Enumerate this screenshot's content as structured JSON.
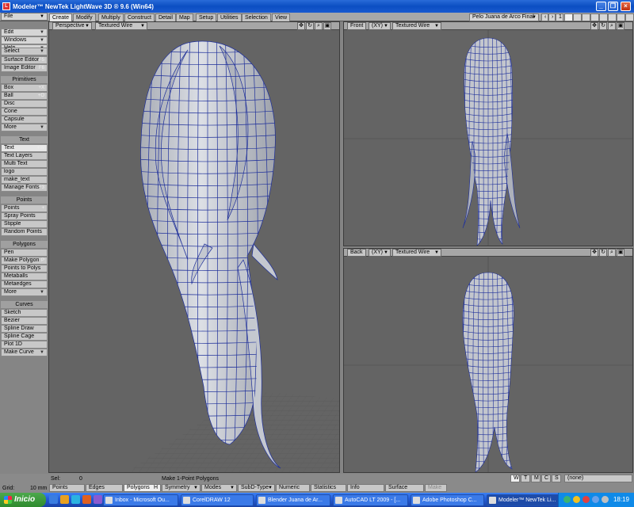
{
  "window": {
    "title": "Modeler™ NewTek LightWave 3D ® 9.6  (Win64)"
  },
  "menus": [
    {
      "label": "File"
    },
    {
      "label": "Edit"
    },
    {
      "label": "Windows"
    },
    {
      "label": "Help"
    }
  ],
  "tabs": [
    "Create",
    "Modify",
    "Multiply",
    "Construct",
    "Detail",
    "Map",
    "Setup",
    "Utilities",
    "Selection",
    "View"
  ],
  "active_tab": "Create",
  "object_selector": "Pelo Juana de Arco Final",
  "layer_number": "1",
  "sidebar": {
    "top": [
      {
        "label": "Select",
        "arrow": true
      },
      {
        "label": "Surface Editor",
        "shortcut": "F5"
      },
      {
        "label": "Image Editor",
        "shortcut": "F6"
      }
    ],
    "groups": [
      {
        "header": "Primitives",
        "items": [
          {
            "label": "Box",
            "shortcut": "+X"
          },
          {
            "label": "Ball",
            "shortcut": "+O"
          },
          {
            "label": "Disc"
          },
          {
            "label": "Cone"
          },
          {
            "label": "Capsule"
          },
          {
            "label": "More",
            "arrow": true
          }
        ]
      },
      {
        "header": "Text",
        "items": [
          {
            "label": "Text",
            "shortcut": "+W"
          },
          {
            "label": "Text Layers"
          },
          {
            "label": "Multi Text"
          },
          {
            "label": "logo"
          },
          {
            "label": "make_text"
          },
          {
            "label": "Manage Fonts",
            "shortcut": "F3"
          }
        ]
      },
      {
        "header": "Points",
        "items": [
          {
            "label": "Points",
            "shortcut": "+"
          },
          {
            "label": "Spray Points"
          },
          {
            "label": "Stipple"
          },
          {
            "label": "Random Points"
          }
        ]
      },
      {
        "header": "Polygons",
        "items": [
          {
            "label": "Pen"
          },
          {
            "label": "Make Polygon",
            "shortcut": "P"
          },
          {
            "label": "Points to Polys"
          },
          {
            "label": "Metaballs"
          },
          {
            "label": "Metaedges"
          },
          {
            "label": "More",
            "arrow": true
          }
        ]
      },
      {
        "header": "Curves",
        "items": [
          {
            "label": "Sketch"
          },
          {
            "label": "Bezier"
          },
          {
            "label": "Spline Draw"
          },
          {
            "label": "Spline Cage"
          },
          {
            "label": "Plot 1D"
          },
          {
            "label": "Make Curve",
            "arrow": true
          }
        ]
      }
    ]
  },
  "viewports": [
    {
      "view": "Perspective",
      "axis": "",
      "mode": "Textured Wire"
    },
    {
      "view": "Front",
      "axis": "(XY)",
      "mode": "Textured Wire"
    },
    {
      "view": "Back",
      "axis": "(XY)",
      "mode": "Textured Wire"
    }
  ],
  "status": {
    "grid_label": "Grid:",
    "grid_value": "10 mm",
    "sel_label": "Sel:",
    "sel_value": "0",
    "hint": "Make 1-Point Polygons",
    "wtmcs": [
      "W",
      "T",
      "M",
      "C",
      "S"
    ],
    "surface_value": "(none)",
    "modes": [
      {
        "label": "Points"
      },
      {
        "label": "Edges"
      },
      {
        "label": "Polygons",
        "shortcut": "H"
      },
      {
        "label": "Symmetry",
        "arrow": true
      },
      {
        "label": "Modes",
        "arrow": true
      },
      {
        "label": "SubD-Type",
        "arrow": true
      },
      {
        "label": "Numeric"
      },
      {
        "label": "Statistics"
      },
      {
        "label": "Info"
      },
      {
        "label": "Surface"
      },
      {
        "label": "Make"
      }
    ]
  },
  "taskbar": {
    "start": "Inicio",
    "tasks": [
      "Inbox - Microsoft Ou...",
      "CorelDRAW 12",
      "Blender Juana de Ar...",
      "AutoCAD LT 2009 - [...",
      "Adobe Photoshop C...",
      "Modeler™ NewTek Li..."
    ],
    "active_task": 5,
    "clock": "18:19"
  },
  "colors": {
    "viewport_bg": "#646464",
    "wire": "#1e2f9a",
    "surface": "#c9ccd4",
    "title_blue": "#0b4ec2"
  }
}
